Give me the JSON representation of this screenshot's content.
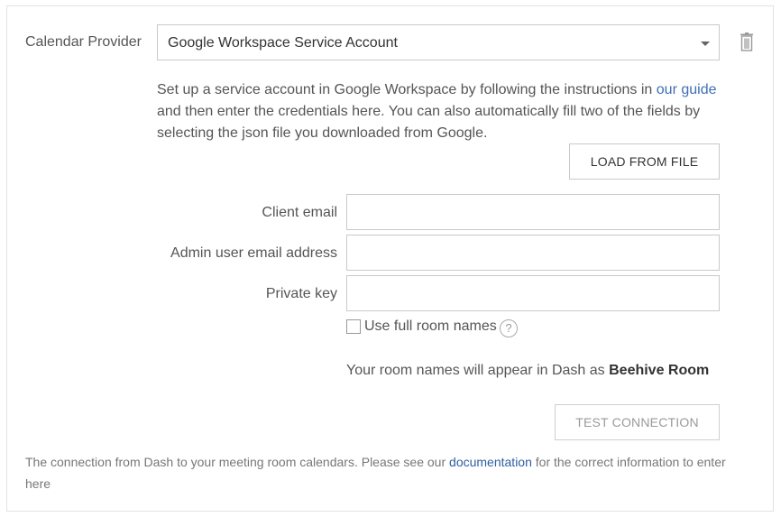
{
  "provider": {
    "label": "Calendar Provider",
    "selected": "Google Workspace Service Account"
  },
  "icons": {
    "delete": "trash-icon",
    "dropdown": "chevron-down-icon",
    "help": "question-circle-icon"
  },
  "intro": {
    "text_before": "Set up a service account in Google Workspace by following the instructions in ",
    "link": "our guide",
    "text_after": " and then enter the credentials here. You can also automatically fill two of the fields by selecting the json file you downloaded from Google."
  },
  "load_button": "LOAD FROM FILE",
  "fields": {
    "client_email": {
      "label": "Client email",
      "value": ""
    },
    "admin_email": {
      "label": "Admin user email address",
      "value": ""
    },
    "private_key": {
      "label": "Private key",
      "value": ""
    }
  },
  "full_room_names": {
    "label": "Use full room names",
    "checked": false,
    "help": "?"
  },
  "preview": {
    "prefix": "Your room names will appear in Dash as ",
    "room_name": "Beehive Room"
  },
  "test_button": "TEST CONNECTION",
  "footer": {
    "text_before": "The connection from Dash to your meeting room calendars. Please see our ",
    "link": "documentation",
    "text_after": " for the correct information to enter here"
  }
}
